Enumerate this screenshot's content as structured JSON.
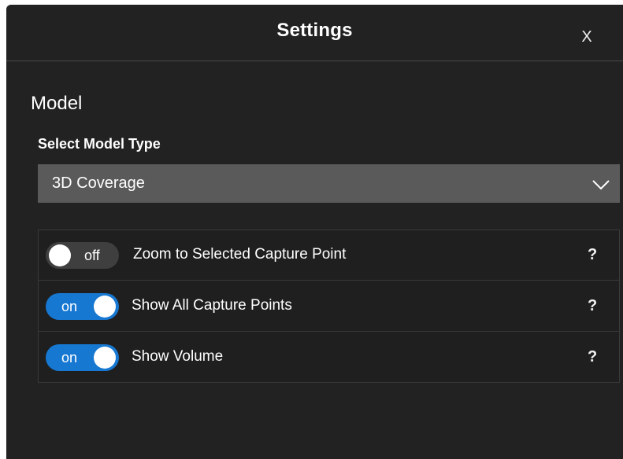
{
  "dialog": {
    "title": "Settings",
    "close_label": "X"
  },
  "model": {
    "section_title": "Model",
    "select_label": "Select Model Type",
    "select_value": "3D Coverage",
    "chevron_icon": "chevron-down-icon"
  },
  "options": [
    {
      "state": "off",
      "toggle_text": "off",
      "label": "Zoom to Selected Capture Point",
      "help": "?"
    },
    {
      "state": "on",
      "toggle_text": "on",
      "label": "Show All Capture Points",
      "help": "?"
    },
    {
      "state": "on",
      "toggle_text": "on",
      "label": "Show Volume",
      "help": "?"
    }
  ],
  "colors": {
    "background": "#222222",
    "toggle_on": "#1778d2",
    "toggle_off": "#3f3f3f",
    "select_bg": "#5a5a5a"
  }
}
